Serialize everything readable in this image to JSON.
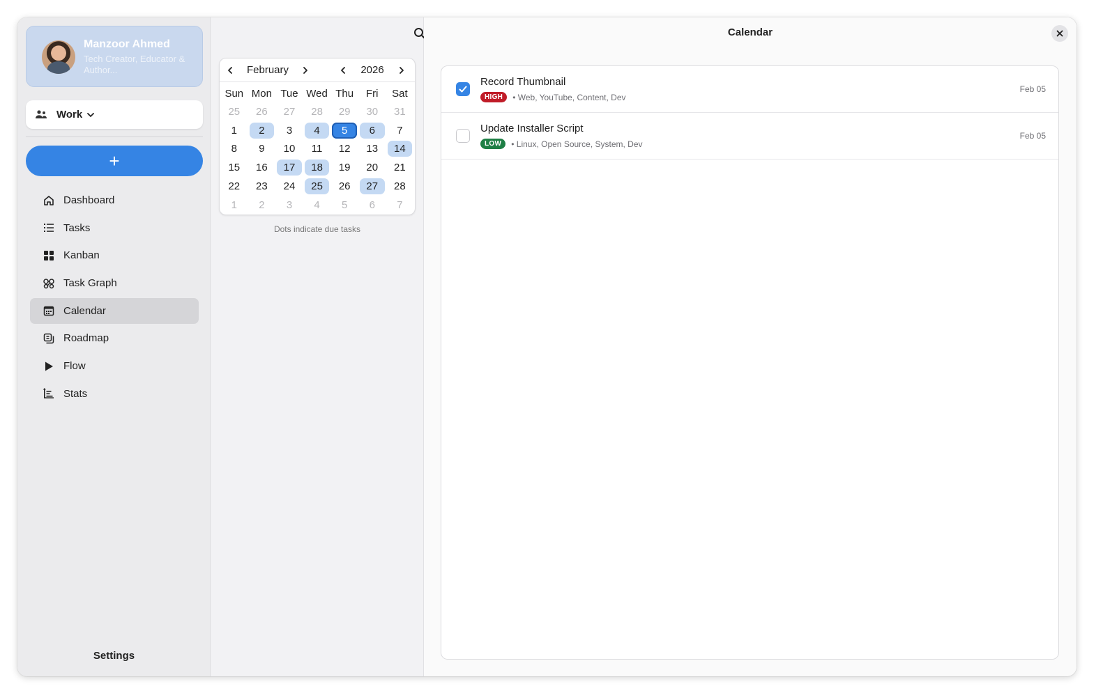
{
  "profile": {
    "name": "Manzoor Ahmed",
    "subtitle": "Tech Creator, Educator & Author..."
  },
  "workspace": {
    "label": "Work"
  },
  "add_button": {
    "label": "+"
  },
  "nav": {
    "items": [
      {
        "label": "Dashboard",
        "icon": "home-icon"
      },
      {
        "label": "Tasks",
        "icon": "list-icon"
      },
      {
        "label": "Kanban",
        "icon": "grid-icon"
      },
      {
        "label": "Task Graph",
        "icon": "graph-icon"
      },
      {
        "label": "Calendar",
        "icon": "calendar-icon",
        "active": true
      },
      {
        "label": "Roadmap",
        "icon": "roadmap-icon"
      },
      {
        "label": "Flow",
        "icon": "play-icon"
      },
      {
        "label": "Stats",
        "icon": "stats-icon"
      }
    ]
  },
  "settings": {
    "label": "Settings"
  },
  "calendar": {
    "month": "February",
    "year": "2026",
    "weekdays": [
      "Sun",
      "Mon",
      "Tue",
      "Wed",
      "Thu",
      "Fri",
      "Sat"
    ],
    "days": [
      {
        "n": "25",
        "other": true
      },
      {
        "n": "26",
        "other": true
      },
      {
        "n": "27",
        "other": true
      },
      {
        "n": "28",
        "other": true
      },
      {
        "n": "29",
        "other": true
      },
      {
        "n": "30",
        "other": true
      },
      {
        "n": "31",
        "other": true
      },
      {
        "n": "1"
      },
      {
        "n": "2",
        "due": true
      },
      {
        "n": "3"
      },
      {
        "n": "4",
        "due": true
      },
      {
        "n": "5",
        "selected": true
      },
      {
        "n": "6",
        "due": true
      },
      {
        "n": "7"
      },
      {
        "n": "8"
      },
      {
        "n": "9"
      },
      {
        "n": "10"
      },
      {
        "n": "11"
      },
      {
        "n": "12"
      },
      {
        "n": "13"
      },
      {
        "n": "14",
        "due": true
      },
      {
        "n": "15"
      },
      {
        "n": "16"
      },
      {
        "n": "17",
        "due": true
      },
      {
        "n": "18",
        "due": true
      },
      {
        "n": "19"
      },
      {
        "n": "20"
      },
      {
        "n": "21"
      },
      {
        "n": "22"
      },
      {
        "n": "23"
      },
      {
        "n": "24"
      },
      {
        "n": "25",
        "due": true
      },
      {
        "n": "26"
      },
      {
        "n": "27",
        "due": true
      },
      {
        "n": "28"
      },
      {
        "n": "1",
        "other": true
      },
      {
        "n": "2",
        "other": true
      },
      {
        "n": "3",
        "other": true
      },
      {
        "n": "4",
        "other": true
      },
      {
        "n": "5",
        "other": true
      },
      {
        "n": "6",
        "other": true
      },
      {
        "n": "7",
        "other": true
      }
    ],
    "hint": "Dots indicate due tasks"
  },
  "main": {
    "title": "Calendar"
  },
  "tasks": [
    {
      "title": "Record Thumbnail",
      "priority": "HIGH",
      "level": "high",
      "tags": "• Web, YouTube, Content, Dev",
      "date": "Feb 05",
      "done": true
    },
    {
      "title": "Update Installer Script",
      "priority": "LOW",
      "level": "low",
      "tags": "• Linux, Open Source, System, Dev",
      "date": "Feb 05",
      "done": false
    }
  ],
  "colors": {
    "accent": "#3584e4",
    "due_highlight": "#c4d9f3",
    "high_badge": "#c01c28",
    "low_badge": "#1e7f45"
  }
}
